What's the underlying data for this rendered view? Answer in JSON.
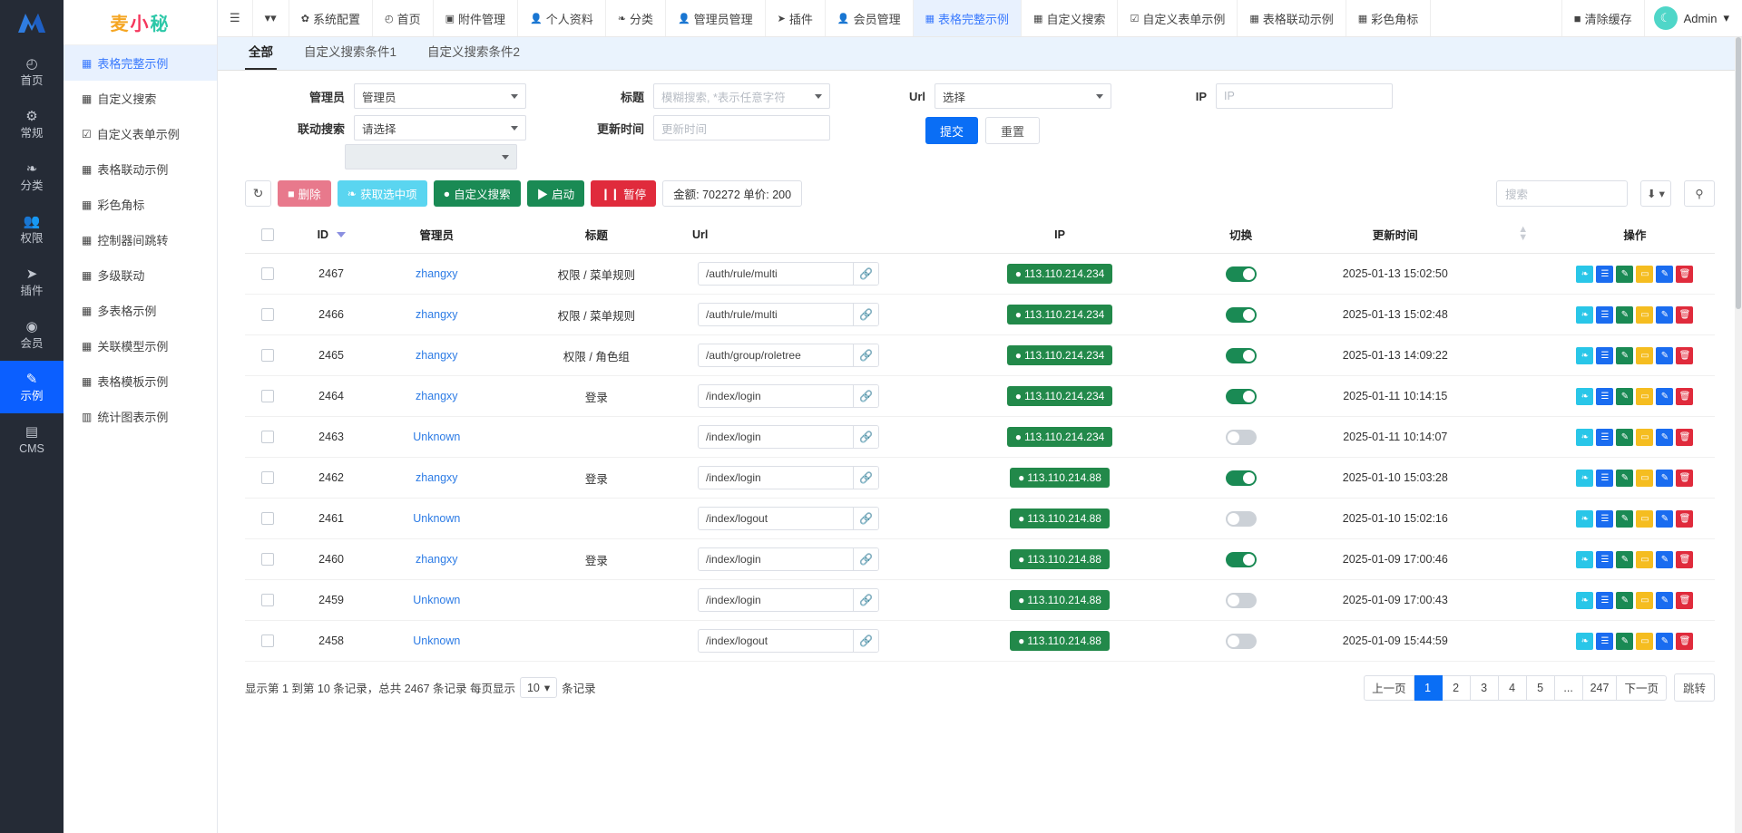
{
  "rail": {
    "logo_icon": "logo-m-icon",
    "items": [
      {
        "icon": "dashboard-icon",
        "glyph": "◴",
        "label": "首页",
        "active": false
      },
      {
        "icon": "cogs-icon",
        "glyph": "⚙",
        "label": "常规",
        "active": false
      },
      {
        "icon": "leaf-icon",
        "glyph": "❧",
        "label": "分类",
        "active": false
      },
      {
        "icon": "users-icon",
        "glyph": "👥",
        "label": "权限",
        "active": false
      },
      {
        "icon": "rocket-icon",
        "glyph": "➤",
        "label": "插件",
        "active": false
      },
      {
        "icon": "user-circle-icon",
        "glyph": "◉",
        "label": "会员",
        "active": false
      },
      {
        "icon": "magic-icon",
        "glyph": "✎",
        "label": "示例",
        "active": true
      },
      {
        "icon": "file-icon",
        "glyph": "▤",
        "label": "CMS",
        "active": false
      }
    ]
  },
  "brand": {
    "char1": "麦",
    "char2": "小",
    "char3": "秘"
  },
  "submenu": {
    "items": [
      {
        "icon": "table-icon",
        "glyph": "▦",
        "label": "表格完整示例",
        "active": true
      },
      {
        "icon": "table-icon",
        "glyph": "▦",
        "label": "自定义搜索",
        "active": false
      },
      {
        "icon": "edit-icon",
        "glyph": "☑",
        "label": "自定义表单示例",
        "active": false
      },
      {
        "icon": "table-icon",
        "glyph": "▦",
        "label": "表格联动示例",
        "active": false
      },
      {
        "icon": "table-icon",
        "glyph": "▦",
        "label": "彩色角标",
        "active": false
      },
      {
        "icon": "table-icon",
        "glyph": "▦",
        "label": "控制器间跳转",
        "active": false
      },
      {
        "icon": "table-icon",
        "glyph": "▦",
        "label": "多级联动",
        "active": false
      },
      {
        "icon": "table-icon",
        "glyph": "▦",
        "label": "多表格示例",
        "active": false
      },
      {
        "icon": "table-icon",
        "glyph": "▦",
        "label": "关联模型示例",
        "active": false
      },
      {
        "icon": "table-icon",
        "glyph": "▦",
        "label": "表格模板示例",
        "active": false
      },
      {
        "icon": "chart-icon",
        "glyph": "▥",
        "label": "统计图表示例",
        "active": false
      }
    ]
  },
  "topnav": {
    "menu_icon": "hamburger-icon",
    "dropdown_icon": "chevron-down-icon",
    "items": [
      {
        "icon": "gear-icon",
        "glyph": "✿",
        "label": "系统配置",
        "active": false
      },
      {
        "icon": "dashboard-icon",
        "glyph": "◴",
        "label": "首页",
        "active": false
      },
      {
        "icon": "image-icon",
        "glyph": "▣",
        "label": "附件管理",
        "active": false
      },
      {
        "icon": "user-icon",
        "glyph": "👤",
        "label": "个人资料",
        "active": false
      },
      {
        "icon": "leaf-icon",
        "glyph": "❧",
        "label": "分类",
        "active": false
      },
      {
        "icon": "user-icon",
        "glyph": "👤",
        "label": "管理员管理",
        "active": false
      },
      {
        "icon": "rocket-icon",
        "glyph": "➤",
        "label": "插件",
        "active": false
      },
      {
        "icon": "user-icon",
        "glyph": "👤",
        "label": "会员管理",
        "active": false
      },
      {
        "icon": "table-icon",
        "glyph": "▦",
        "label": "表格完整示例",
        "active": true
      },
      {
        "icon": "table-icon",
        "glyph": "▦",
        "label": "自定义搜索",
        "active": false
      },
      {
        "icon": "edit-icon",
        "glyph": "☑",
        "label": "自定义表单示例",
        "active": false
      },
      {
        "icon": "table-icon",
        "glyph": "▦",
        "label": "表格联动示例",
        "active": false
      },
      {
        "icon": "table-icon",
        "glyph": "▦",
        "label": "彩色角标",
        "active": false
      }
    ],
    "clear_cache": {
      "icon": "trash-icon",
      "glyph": "🗑",
      "label": "清除缓存"
    },
    "user": {
      "avatar_icon": "avatar-icon",
      "name": "Admin",
      "caret_icon": "caret-down-icon"
    }
  },
  "tabs": [
    {
      "label": "全部",
      "active": true
    },
    {
      "label": "自定义搜索条件1",
      "active": false
    },
    {
      "label": "自定义搜索条件2",
      "active": false
    }
  ],
  "search_form": {
    "admin": {
      "label": "管理员",
      "value": "管理员"
    },
    "linkage": {
      "label": "联动搜索",
      "value": "请选择",
      "value2": ""
    },
    "title": {
      "label": "标题",
      "placeholder": "模糊搜索, *表示任意字符"
    },
    "update_time": {
      "label": "更新时间",
      "placeholder": "更新时间"
    },
    "url": {
      "label": "Url",
      "value": "选择"
    },
    "ip": {
      "label": "IP",
      "placeholder": "IP"
    },
    "submit_label": "提交",
    "reset_label": "重置"
  },
  "toolbar": {
    "refresh_icon": "refresh-icon",
    "delete_label": "删除",
    "get_selected_label": "获取选中项",
    "custom_search_label": "自定义搜索",
    "start_label": "启动",
    "pause_label": "暂停",
    "amount_label": "金额: 702272 单价: 200",
    "search_placeholder": "搜索",
    "export_icon": "download-icon",
    "search_icon": "search-icon"
  },
  "table": {
    "columns": [
      "",
      "ID",
      "管理员",
      "标题",
      "Url",
      "IP",
      "切换",
      "更新时间",
      "",
      "操作"
    ],
    "rows": [
      {
        "id": "2467",
        "admin": "zhangxy",
        "title": "权限 / 菜单规则",
        "url": "/auth/rule/multi",
        "ip": "113.110.214.234",
        "toggle": true,
        "updated": "2025-01-13 15:02:50"
      },
      {
        "id": "2466",
        "admin": "zhangxy",
        "title": "权限 / 菜单规则",
        "url": "/auth/rule/multi",
        "ip": "113.110.214.234",
        "toggle": true,
        "updated": "2025-01-13 15:02:48"
      },
      {
        "id": "2465",
        "admin": "zhangxy",
        "title": "权限 / 角色组",
        "url": "/auth/group/roletree",
        "ip": "113.110.214.234",
        "toggle": true,
        "updated": "2025-01-13 14:09:22"
      },
      {
        "id": "2464",
        "admin": "zhangxy",
        "title": "登录",
        "url": "/index/login",
        "ip": "113.110.214.234",
        "toggle": true,
        "updated": "2025-01-11 10:14:15"
      },
      {
        "id": "2463",
        "admin": "Unknown",
        "title": "",
        "url": "/index/login",
        "ip": "113.110.214.234",
        "toggle": false,
        "updated": "2025-01-11 10:14:07"
      },
      {
        "id": "2462",
        "admin": "zhangxy",
        "title": "登录",
        "url": "/index/login",
        "ip": "113.110.214.88",
        "toggle": true,
        "updated": "2025-01-10 15:03:28"
      },
      {
        "id": "2461",
        "admin": "Unknown",
        "title": "",
        "url": "/index/logout",
        "ip": "113.110.214.88",
        "toggle": false,
        "updated": "2025-01-10 15:02:16"
      },
      {
        "id": "2460",
        "admin": "zhangxy",
        "title": "登录",
        "url": "/index/login",
        "ip": "113.110.214.88",
        "toggle": true,
        "updated": "2025-01-09 17:00:46"
      },
      {
        "id": "2459",
        "admin": "Unknown",
        "title": "",
        "url": "/index/login",
        "ip": "113.110.214.88",
        "toggle": false,
        "updated": "2025-01-09 17:00:43"
      },
      {
        "id": "2458",
        "admin": "Unknown",
        "title": "",
        "url": "/index/logout",
        "ip": "113.110.214.88",
        "toggle": false,
        "updated": "2025-01-09 15:44:59"
      }
    ],
    "row_ops": [
      {
        "name": "leaf-op-icon",
        "glyph": "❧",
        "cls": "op-cyan"
      },
      {
        "name": "list-op-icon",
        "glyph": "☰",
        "cls": "op-blue"
      },
      {
        "name": "magic-op-icon",
        "glyph": "✎",
        "cls": "op-green"
      },
      {
        "name": "folder-op-icon",
        "glyph": "▭",
        "cls": "op-yellow"
      },
      {
        "name": "edit-op-icon",
        "glyph": "✎",
        "cls": "op-edit"
      },
      {
        "name": "delete-op-icon",
        "glyph": "🗑",
        "cls": "op-red"
      }
    ]
  },
  "footer": {
    "info_prefix": "显示第 1 到第 10 条记录，总共 2467 条记录 每页显示",
    "page_size": "10",
    "info_suffix": "条记录",
    "pages": [
      "上一页",
      "1",
      "2",
      "3",
      "4",
      "5",
      "...",
      "247",
      "下一页"
    ],
    "current_page": "1",
    "jump_label": "跳转"
  }
}
